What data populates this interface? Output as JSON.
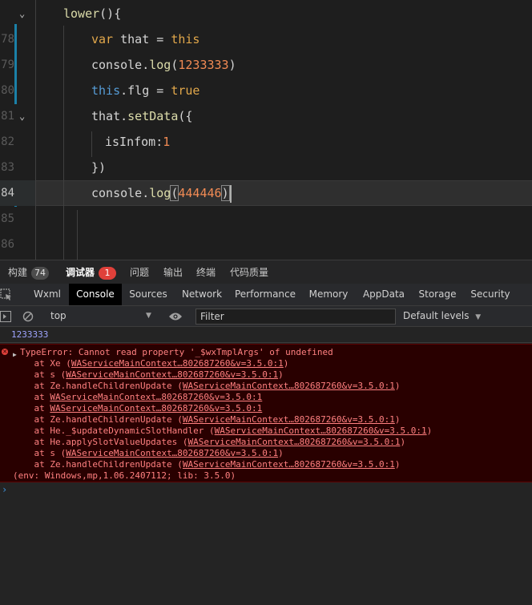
{
  "editor": {
    "lines": [
      {
        "n": "",
        "tokens": [
          [
            "k-func",
            "lower"
          ],
          [
            "br",
            "(){"
          ]
        ]
      },
      {
        "n": "78",
        "tokens": [
          [
            "k-orange",
            "var "
          ],
          [
            "k-prop",
            "that"
          ],
          [
            "br",
            " = "
          ],
          [
            "k-orange",
            "this"
          ]
        ]
      },
      {
        "n": "79",
        "tokens": [
          [
            "k-prop",
            "console"
          ],
          [
            "br",
            "."
          ],
          [
            "k-func",
            "log"
          ],
          [
            "br",
            "("
          ],
          [
            "k-num",
            "1233333"
          ],
          [
            "br",
            ")"
          ]
        ]
      },
      {
        "n": "80",
        "tokens": [
          [
            "k-kw",
            "this"
          ],
          [
            "br",
            "."
          ],
          [
            "k-prop",
            "flg"
          ],
          [
            "br",
            " = "
          ],
          [
            "k-orange",
            "true"
          ]
        ]
      },
      {
        "n": "81",
        "tokens": [
          [
            "k-prop",
            "that"
          ],
          [
            "br",
            "."
          ],
          [
            "k-func",
            "setData"
          ],
          [
            "br",
            "({"
          ]
        ]
      },
      {
        "n": "82",
        "tokens": [
          [
            "k-prop",
            "isInfom"
          ],
          [
            "br",
            ":"
          ],
          [
            "k-num",
            "1"
          ]
        ]
      },
      {
        "n": "83",
        "tokens": [
          [
            "br",
            "})"
          ]
        ]
      },
      {
        "n": "84",
        "tokens": [
          [
            "k-prop",
            "console"
          ],
          [
            "br",
            "."
          ],
          [
            "k-func",
            "log"
          ],
          [
            "br",
            "("
          ],
          [
            "k-num",
            "444446"
          ],
          [
            "br",
            ")"
          ]
        ]
      },
      {
        "n": "85",
        "tokens": []
      },
      {
        "n": "86",
        "tokens": []
      }
    ]
  },
  "panel_tabs": [
    {
      "label": "构建",
      "badge": "74",
      "badge_style": "gray"
    },
    {
      "label": "调试器",
      "badge": "1",
      "badge_style": "red",
      "active": true
    },
    {
      "label": "问题"
    },
    {
      "label": "输出"
    },
    {
      "label": "终端"
    },
    {
      "label": "代码质量"
    }
  ],
  "dev_tabs": [
    "Wxml",
    "Console",
    "Sources",
    "Network",
    "Performance",
    "Memory",
    "AppData",
    "Storage",
    "Security"
  ],
  "dev_tabs_active": "Console",
  "toolbar": {
    "context": "top",
    "filter_placeholder": "Filter",
    "levels": "Default levels"
  },
  "console": {
    "log_value": "1233333",
    "error_message": "TypeError: Cannot read property '_$wxTmplArgs' of undefined",
    "stack": [
      {
        "prefix": "    at Xe (",
        "link": "WAServiceMainContext…802687260&v=3.5.0:1",
        "suffix": ")"
      },
      {
        "prefix": "    at s (",
        "link": "WAServiceMainContext…802687260&v=3.5.0:1",
        "suffix": ")"
      },
      {
        "prefix": "    at Ze.handleChildrenUpdate (",
        "link": "WAServiceMainContext…802687260&v=3.5.0:1",
        "suffix": ")"
      },
      {
        "prefix": "    at ",
        "link": "WAServiceMainContext…802687260&v=3.5.0:1",
        "suffix": ""
      },
      {
        "prefix": "    at ",
        "link": "WAServiceMainContext…802687260&v=3.5.0:1",
        "suffix": ""
      },
      {
        "prefix": "    at Ze.handleChildrenUpdate (",
        "link": "WAServiceMainContext…802687260&v=3.5.0:1",
        "suffix": ")"
      },
      {
        "prefix": "    at He._$updateDynamicSlotHandler (",
        "link": "WAServiceMainContext…802687260&v=3.5.0:1",
        "suffix": ")"
      },
      {
        "prefix": "    at He.applySlotValueUpdates (",
        "link": "WAServiceMainContext…802687260&v=3.5.0:1",
        "suffix": ")"
      },
      {
        "prefix": "    at s (",
        "link": "WAServiceMainContext…802687260&v=3.5.0:1",
        "suffix": ")"
      },
      {
        "prefix": "    at Ze.handleChildrenUpdate (",
        "link": "WAServiceMainContext…802687260&v=3.5.0:1",
        "suffix": ")"
      }
    ],
    "env": "(env: Windows,mp,1.06.2407112; lib: 3.5.0)",
    "prompt": "›"
  }
}
